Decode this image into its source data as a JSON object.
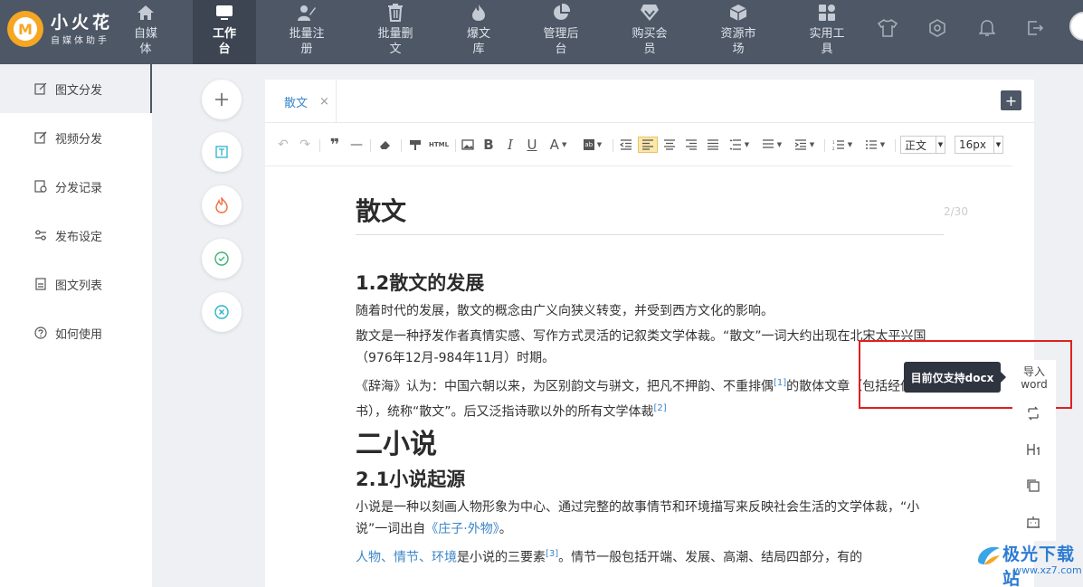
{
  "brand": {
    "name": "小火花",
    "tagline": "自媒体助手",
    "logo_letter": "M"
  },
  "nav": [
    {
      "label": "自媒体",
      "icon": "home-icon"
    },
    {
      "label": "工作台",
      "icon": "monitor-icon",
      "active": true
    },
    {
      "label": "批量注册",
      "icon": "register-icon"
    },
    {
      "label": "批量删文",
      "icon": "trash-icon"
    },
    {
      "label": "爆文库",
      "icon": "fire-icon"
    },
    {
      "label": "管理后台",
      "icon": "pie-icon"
    },
    {
      "label": "购买会员",
      "icon": "diamond-icon"
    },
    {
      "label": "资源市场",
      "icon": "cube-icon"
    },
    {
      "label": "实用工具",
      "icon": "grid-icon"
    }
  ],
  "sidebar": [
    {
      "label": "图文分发",
      "icon": "edit-icon",
      "active": true
    },
    {
      "label": "视频分发",
      "icon": "video-edit-icon"
    },
    {
      "label": "分发记录",
      "icon": "record-icon"
    },
    {
      "label": "发布设定",
      "icon": "settings-sliders-icon"
    },
    {
      "label": "图文列表",
      "icon": "list-icon"
    },
    {
      "label": "如何使用",
      "icon": "help-icon"
    }
  ],
  "editor": {
    "tab_label": "散文",
    "tab_close": "×",
    "add_label": "+",
    "html_btn": "HTML",
    "style_select": "正文",
    "size_select": "16px",
    "doc_title": "散文",
    "title_counter": "2/30",
    "content": {
      "h2a": "1.2散文的发展",
      "p1": "随着时代的发展，散文的概念由广义向狭义转变，并受到西方文化的影响。",
      "p2": "散文是一种抒发作者真情实感、写作方式灵活的记叙类文学体裁。“散文”一词大约出现在北宋太平兴国（976年12月-984年11月）时期。",
      "p3a": "《辞海》认为：中国六朝以来，为区别韵文与骈文，把凡不押韵、不重排偶",
      "sup1": "[1]",
      "p3b": "的散体文章（包括经传史书），统称“散文”。后又泛指诗歌以外的所有文学体裁",
      "sup2": "[2]",
      "h1": "二小说",
      "h2b": "2.1小说起源",
      "p4a": "小说是一种以刻画人物形象为中心、通过完整的故事情节和环境描写来反映社会生活的文学体裁，“小说”一词出自",
      "p4link": "《庄子·外物》",
      "p4b": "。",
      "p5link": "人物、情节、环境",
      "p5a": "是小说的三要素",
      "sup3": "[3]",
      "p5b": "。情节一般包括开端、发展、高潮、结局四部分，有的"
    }
  },
  "tooltip": "目前仅支持docx",
  "import_word": {
    "line1": "导入",
    "line2": "word"
  },
  "watermark": {
    "main": "极光下载站",
    "url": "www.xz7.com"
  },
  "colors": {
    "topbar": "#4d5766",
    "accent": "#3a86c8",
    "highlight": "#e02020"
  }
}
